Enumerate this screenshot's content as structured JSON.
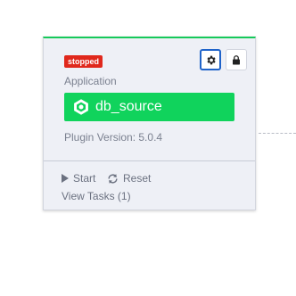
{
  "node": {
    "status": "stopped",
    "type": "Application",
    "name": "db_source",
    "plugin_version": "Plugin Version: 5.0.4",
    "actions": {
      "start_label": "Start",
      "reset_label": "Reset",
      "view_tasks_label": "View Tasks (1)"
    }
  },
  "icons": {
    "settings": "gear-icon",
    "lock": "lock-icon",
    "app": "hexagon-icon",
    "start": "play-icon",
    "reset": "refresh-icon"
  },
  "colors": {
    "status_stopped": "#e0281c",
    "name_bar": "#10d35c",
    "card_top_border": "#16c95a",
    "selected_outline": "#1f63c9",
    "card_background": "#eef0f6"
  }
}
